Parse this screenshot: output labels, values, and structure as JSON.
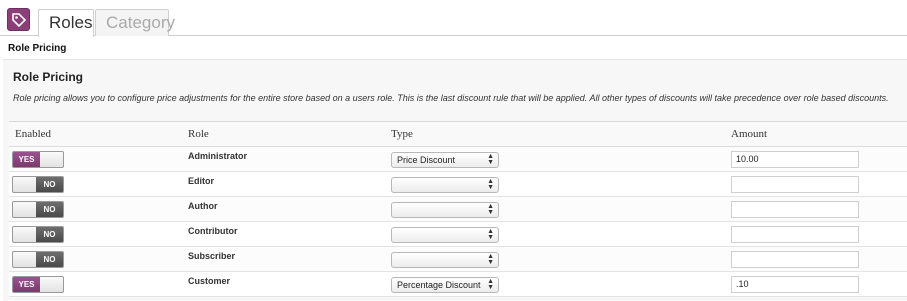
{
  "tabs": [
    {
      "label": "Roles",
      "active": true
    },
    {
      "label": "Category",
      "active": false
    }
  ],
  "page_heading": "Role Pricing",
  "section": {
    "title": "Role Pricing",
    "description": "Role pricing allows you to configure price adjustments for the entire store based on a users role. This is the last discount rule that will be applied. All other types of discounts will take precedence over role based discounts."
  },
  "table": {
    "headers": {
      "enabled": "Enabled",
      "role": "Role",
      "type": "Type",
      "amount": "Amount"
    },
    "rows": [
      {
        "toggle": "YES",
        "enabled": true,
        "role": "Administrator",
        "type": "Price Discount",
        "amount": "10.00"
      },
      {
        "toggle": "NO",
        "enabled": false,
        "role": "Editor",
        "type": "",
        "amount": ""
      },
      {
        "toggle": "NO",
        "enabled": false,
        "role": "Author",
        "type": "",
        "amount": ""
      },
      {
        "toggle": "NO",
        "enabled": false,
        "role": "Contributor",
        "type": "",
        "amount": ""
      },
      {
        "toggle": "NO",
        "enabled": false,
        "role": "Subscriber",
        "type": "",
        "amount": ""
      },
      {
        "toggle": "YES",
        "enabled": true,
        "role": "Customer",
        "type": "Percentage Discount",
        "amount": ".10"
      }
    ]
  },
  "colors": {
    "accent": "#8a3f78",
    "toggle_off": "#555555"
  },
  "icons": {
    "tab_icon": "price-tag-icon",
    "select_arrows": "updown-arrows-icon"
  }
}
